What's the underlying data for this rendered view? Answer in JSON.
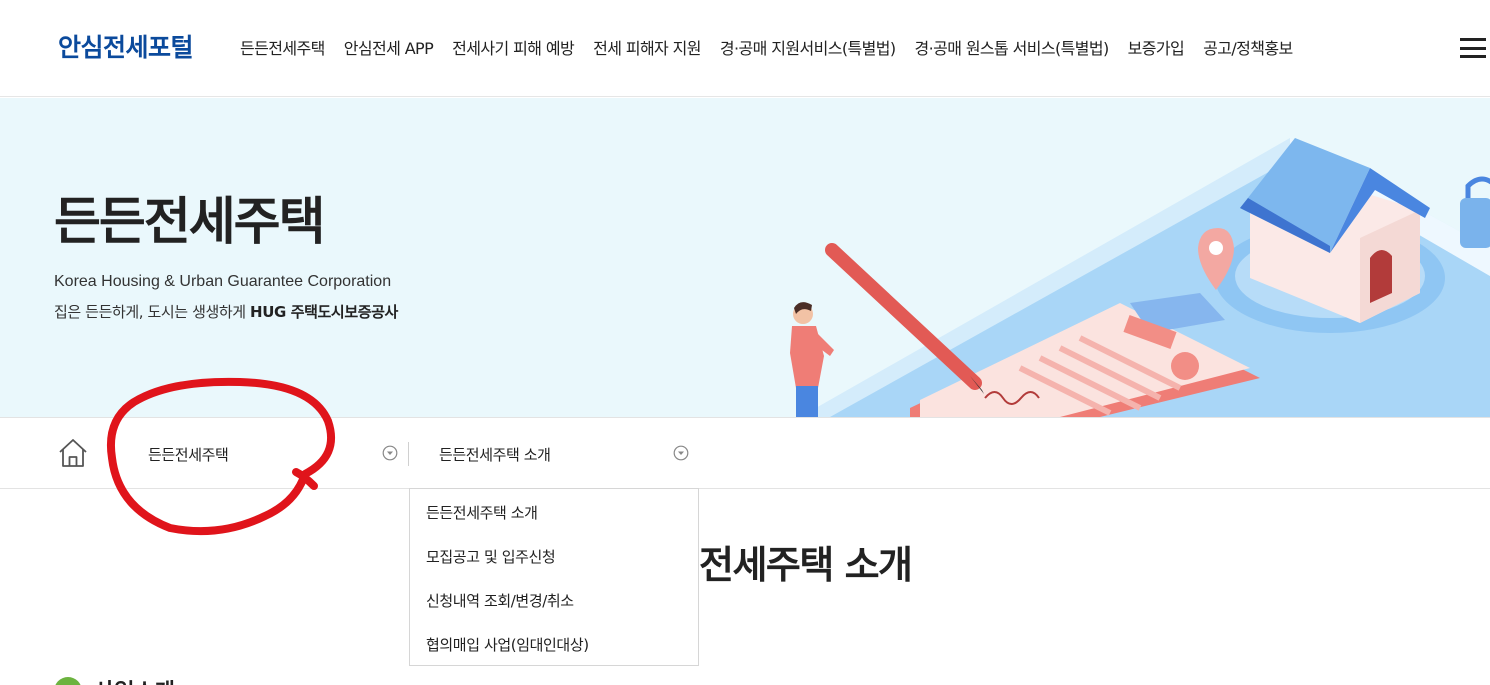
{
  "header": {
    "logo": "안심전세포털",
    "nav": [
      "든든전세주택",
      "안심전세 APP",
      "전세사기 피해 예방",
      "전세 피해자 지원",
      "경·공매 지원서비스(특별법)",
      "경·공매 원스톱 서비스(특별법)",
      "보증가입",
      "공고/정책홍보"
    ]
  },
  "banner": {
    "title": "든든전세주택",
    "subtitle_en": "Korea Housing & Urban Guarantee Corporation",
    "subtitle_ko_prefix": "집은 든든하게, 도시는 생생하게 ",
    "subtitle_ko_bold": "HUG 주택도시보증공사"
  },
  "location": {
    "depth1": "든든전세주택",
    "depth2": "든든전세주택 소개"
  },
  "dropdown": {
    "items": [
      "든든전세주택 소개",
      "모집공고 및 입주신청",
      "신청내역 조회/변경/취소",
      "협의매입 사업(임대인대상)"
    ]
  },
  "page": {
    "title": "전세주택 소개",
    "section_heading": "사업소개"
  },
  "colors": {
    "brand": "#0b4a9c",
    "banner_bg": "#eaf8fc",
    "annotation": "#e0141b",
    "section_dot": "#6cb33f"
  },
  "icons": [
    "menu-icon",
    "home-icon",
    "chevron-down-circle-icon"
  ]
}
